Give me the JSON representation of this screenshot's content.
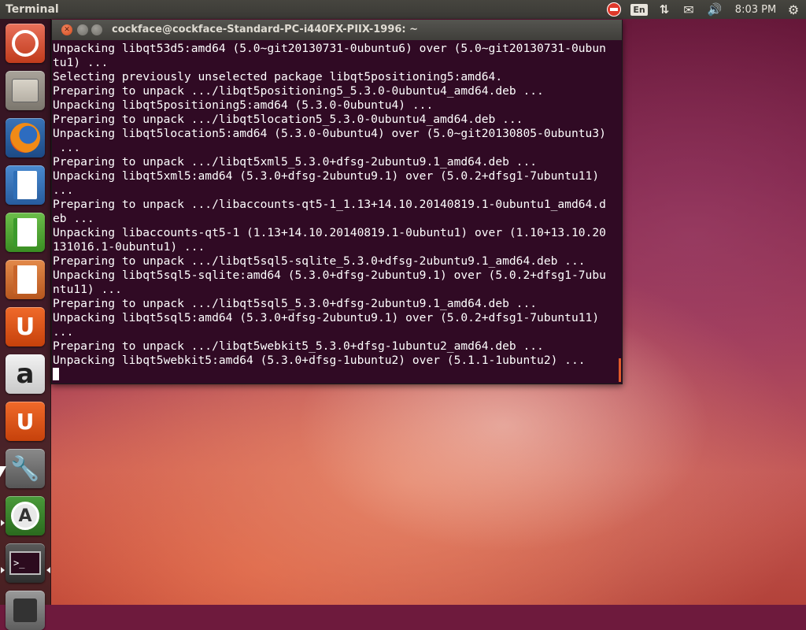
{
  "top_panel": {
    "title": "Terminal",
    "lang": "En",
    "clock": "8:03 PM",
    "net_glyph": "⇅",
    "mail_glyph": "✉",
    "sound_glyph": "🔊",
    "gear_glyph": "⚙"
  },
  "launcher": {
    "items": [
      {
        "name": "Dash Home",
        "icon": "ubuntu-logo-icon"
      },
      {
        "name": "Files",
        "icon": "file-cabinet-icon"
      },
      {
        "name": "Firefox Web Browser",
        "icon": "firefox-icon"
      },
      {
        "name": "LibreOffice Writer",
        "icon": "writer-icon"
      },
      {
        "name": "LibreOffice Calc",
        "icon": "calc-icon"
      },
      {
        "name": "LibreOffice Impress",
        "icon": "impress-icon"
      },
      {
        "name": "Ubuntu Software Center",
        "icon": "ubuntu-one-icon",
        "glyph": "U"
      },
      {
        "name": "Amazon",
        "icon": "amazon-icon",
        "glyph": "a"
      },
      {
        "name": "Ubuntu One Music",
        "icon": "music-icon",
        "glyph": "U"
      },
      {
        "name": "System Settings",
        "icon": "settings-icon",
        "glyph": "🔧"
      },
      {
        "name": "Software Updater",
        "icon": "software-updater-icon",
        "glyph": "A"
      },
      {
        "name": "Terminal",
        "icon": "terminal-icon",
        "glyph": ">_"
      },
      {
        "name": "Save",
        "icon": "floppy-icon"
      }
    ]
  },
  "terminal": {
    "title": "cockface@cockface-Standard-PC-i440FX-PIIX-1996: ~",
    "lines": [
      "Unpacking libqt53d5:amd64 (5.0~git20130731-0ubuntu6) over (5.0~git20130731-0ubun",
      "tu1) ...",
      "Selecting previously unselected package libqt5positioning5:amd64.",
      "Preparing to unpack .../libqt5positioning5_5.3.0-0ubuntu4_amd64.deb ...",
      "Unpacking libqt5positioning5:amd64 (5.3.0-0ubuntu4) ...",
      "Preparing to unpack .../libqt5location5_5.3.0-0ubuntu4_amd64.deb ...",
      "Unpacking libqt5location5:amd64 (5.3.0-0ubuntu4) over (5.0~git20130805-0ubuntu3)",
      " ...",
      "Preparing to unpack .../libqt5xml5_5.3.0+dfsg-2ubuntu9.1_amd64.deb ...",
      "Unpacking libqt5xml5:amd64 (5.3.0+dfsg-2ubuntu9.1) over (5.0.2+dfsg1-7ubuntu11)",
      "...",
      "Preparing to unpack .../libaccounts-qt5-1_1.13+14.10.20140819.1-0ubuntu1_amd64.d",
      "eb ...",
      "Unpacking libaccounts-qt5-1 (1.13+14.10.20140819.1-0ubuntu1) over (1.10+13.10.20",
      "131016.1-0ubuntu1) ...",
      "Preparing to unpack .../libqt5sql5-sqlite_5.3.0+dfsg-2ubuntu9.1_amd64.deb ...",
      "Unpacking libqt5sql5-sqlite:amd64 (5.3.0+dfsg-2ubuntu9.1) over (5.0.2+dfsg1-7ubu",
      "ntu11) ...",
      "Preparing to unpack .../libqt5sql5_5.3.0+dfsg-2ubuntu9.1_amd64.deb ...",
      "Unpacking libqt5sql5:amd64 (5.3.0+dfsg-2ubuntu9.1) over (5.0.2+dfsg1-7ubuntu11)",
      "...",
      "Preparing to unpack .../libqt5webkit5_5.3.0+dfsg-1ubuntu2_amd64.deb ...",
      "Unpacking libqt5webkit5:amd64 (5.3.0+dfsg-1ubuntu2) over (5.1.1-1ubuntu2) ..."
    ]
  }
}
